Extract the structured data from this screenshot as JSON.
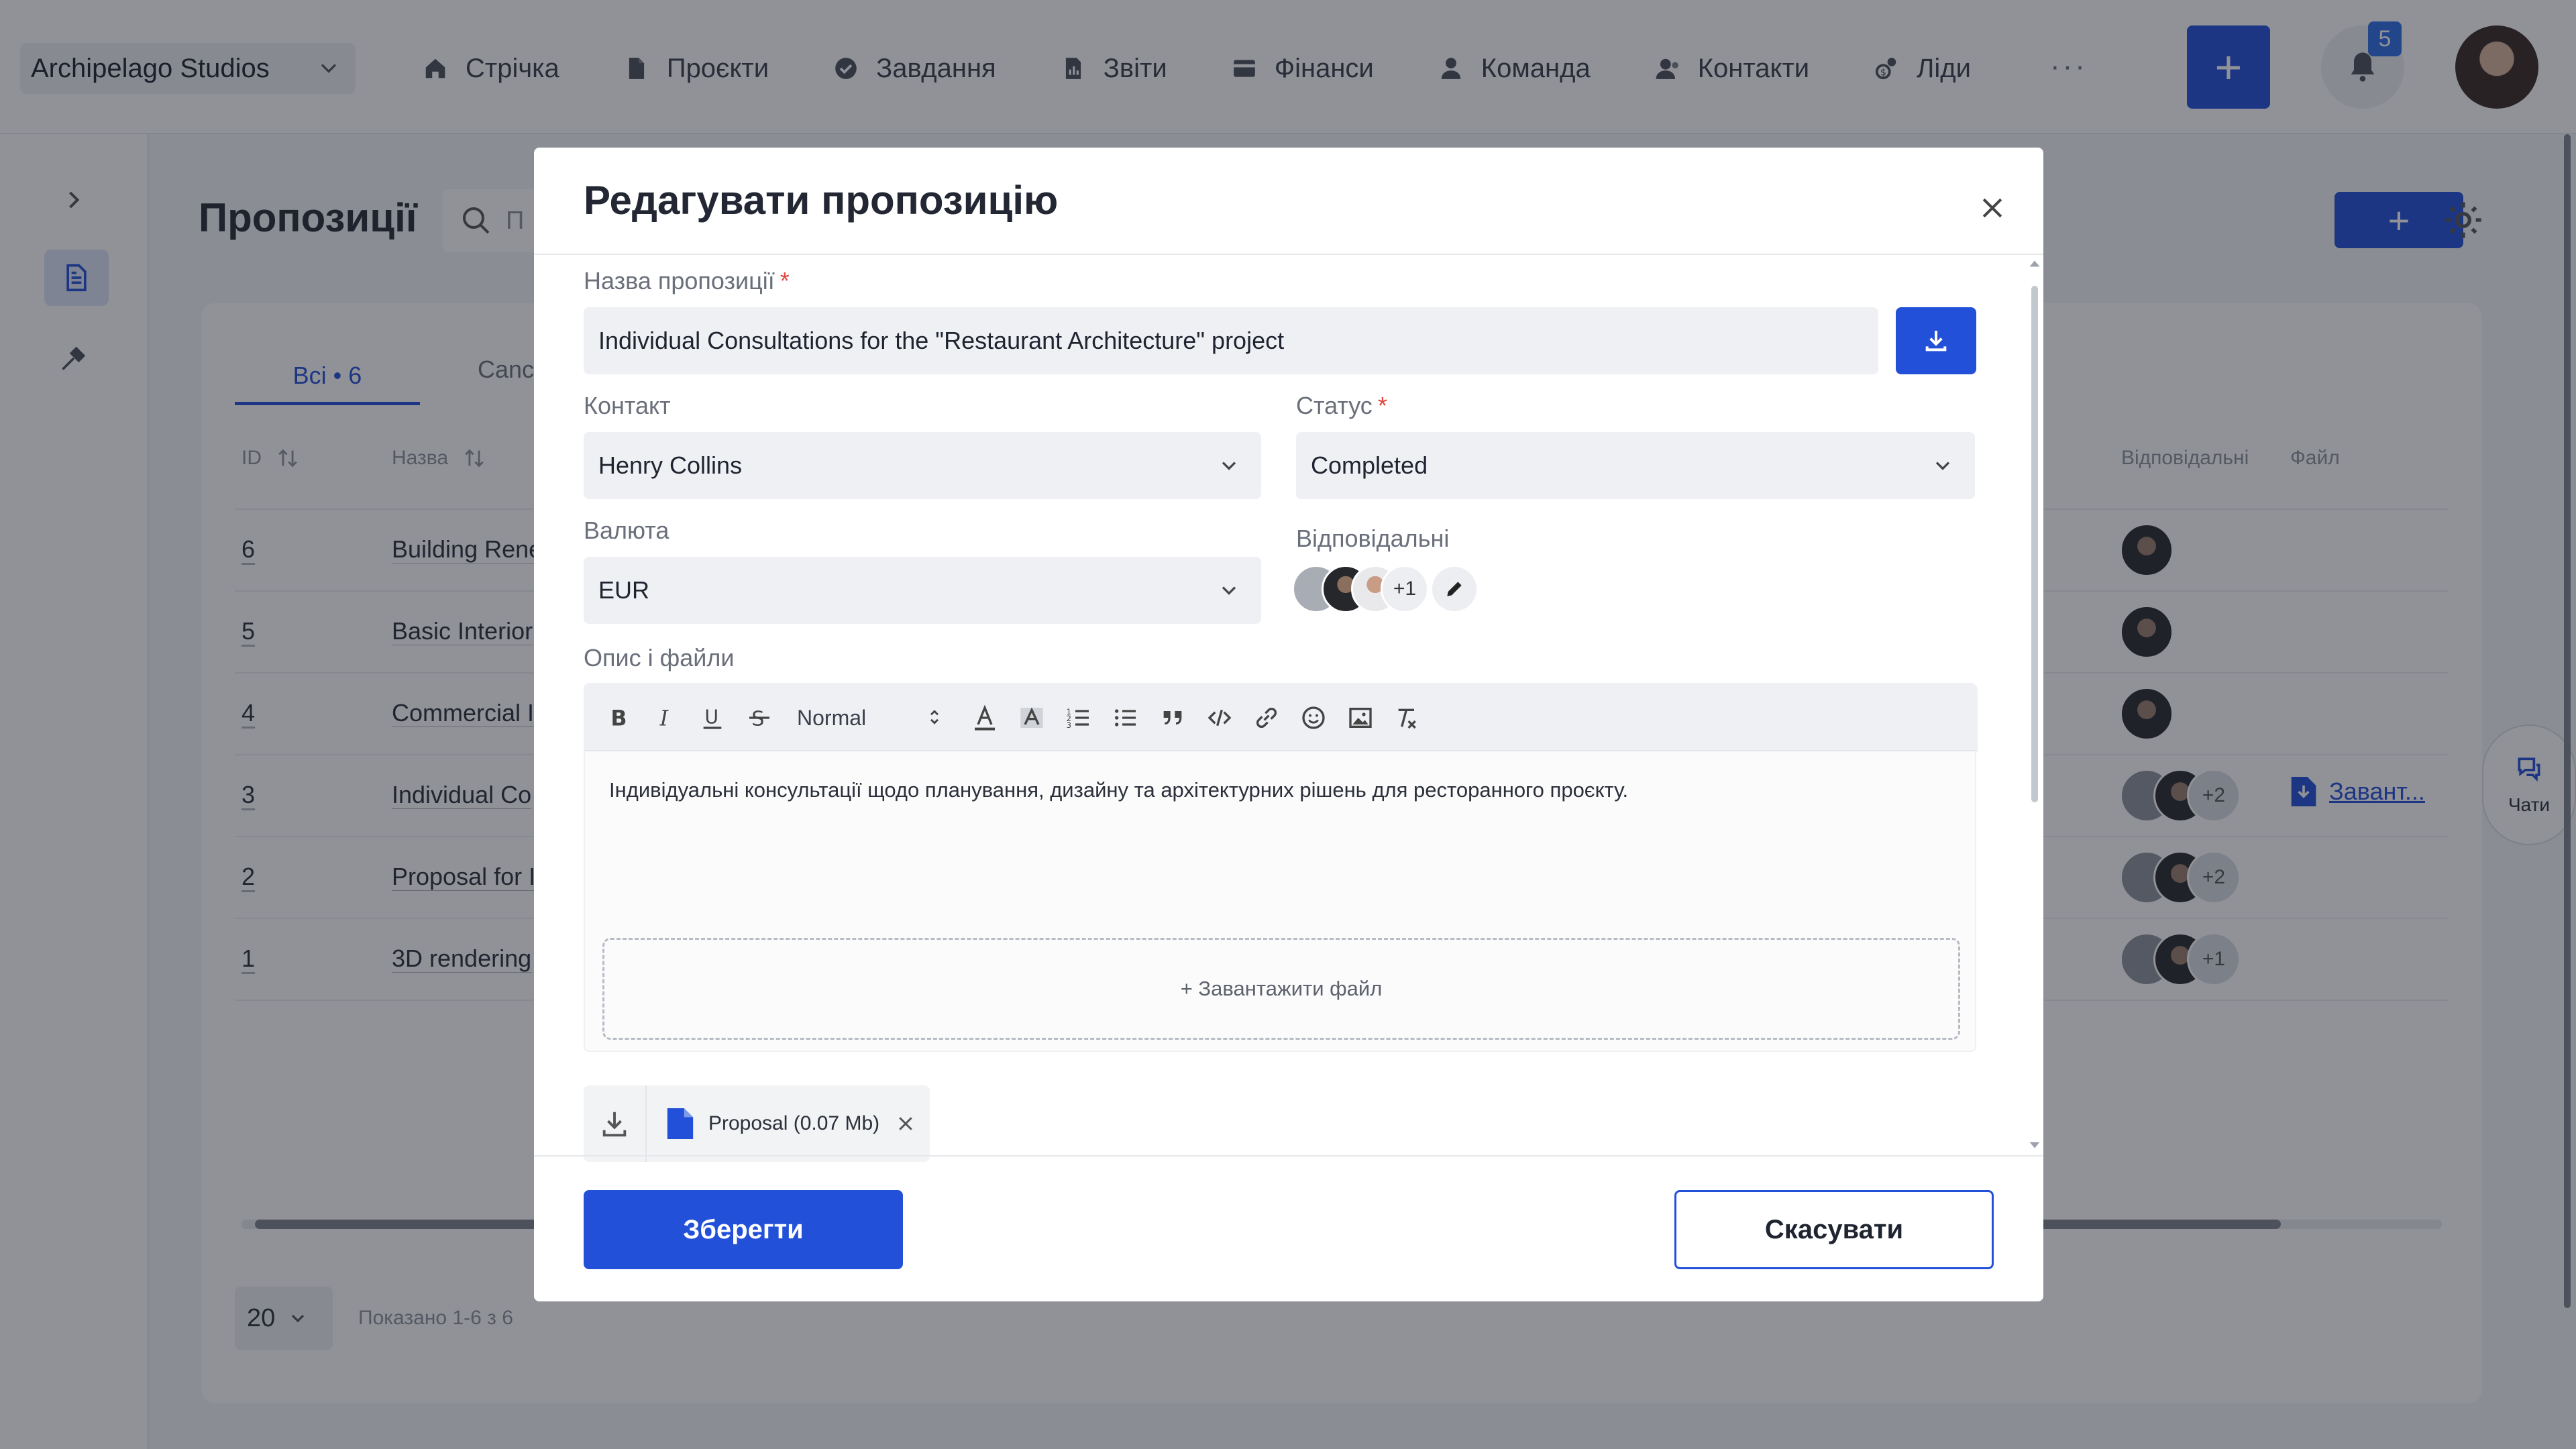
{
  "app": {
    "workspace": "Archipelago Studios",
    "nav": [
      "Стрічка",
      "Проєкти",
      "Завдання",
      "Звіти",
      "Фінанси",
      "Команда",
      "Контакти",
      "Ліди"
    ],
    "nav_icons": [
      "home-icon",
      "document-icon",
      "check-circle-icon",
      "report-icon",
      "wallet-icon",
      "user-icon",
      "contacts-icon",
      "leads-icon"
    ],
    "more": "···",
    "add": "+",
    "notifications_count": "5"
  },
  "page": {
    "title": "Пропозиції",
    "search_placeholder": "П",
    "add_button": "+",
    "tabs": [
      "Всі • 6",
      "Canc"
    ],
    "columns": {
      "id": "ID",
      "name": "Назва",
      "responsible": "Відповідальні",
      "file": "Файл"
    },
    "rows": [
      {
        "id": "6",
        "name": "Building Rene"
      },
      {
        "id": "5",
        "name": "Basic Interior"
      },
      {
        "id": "4",
        "name": "Commercial I"
      },
      {
        "id": "3",
        "name": "Individual Co"
      },
      {
        "id": "2",
        "name": "Proposal for I"
      },
      {
        "id": "1",
        "name": "3D rendering"
      }
    ],
    "row_extra": [
      "+2",
      "+2",
      "+1"
    ],
    "file_link": "Завант...",
    "per_page": "20",
    "shown": "Показано 1-6 з 6",
    "chats": "Чати"
  },
  "modal": {
    "title": "Редагувати пропозицію",
    "name_label": "Назва пропозиції",
    "required_mark": "*",
    "name_value": "Individual Consultations for the \"Restaurant Architecture\" project",
    "contact_label": "Контакт",
    "contact_value": "Henry Collins",
    "status_label": "Статус",
    "status_value": "Completed",
    "currency_label": "Валюта",
    "currency_value": "EUR",
    "responsible_label": "Відповідальні",
    "responsible_extra": "+1",
    "description_label": "Опис і файли",
    "format_select": "Normal",
    "description_text": "Індивідуальні консультації щодо планування, дизайну та архітектурних рішень для ресторанного проєкту.",
    "upload_text": "+ Завантажити файл",
    "attachment": "Proposal (0.07 Mb)",
    "save": "Зберегти",
    "cancel": "Скасувати"
  },
  "colors": {
    "accent": "#2350d8",
    "required": "#e0463e",
    "overlay": "rgba(23,28,38,0.48)"
  }
}
